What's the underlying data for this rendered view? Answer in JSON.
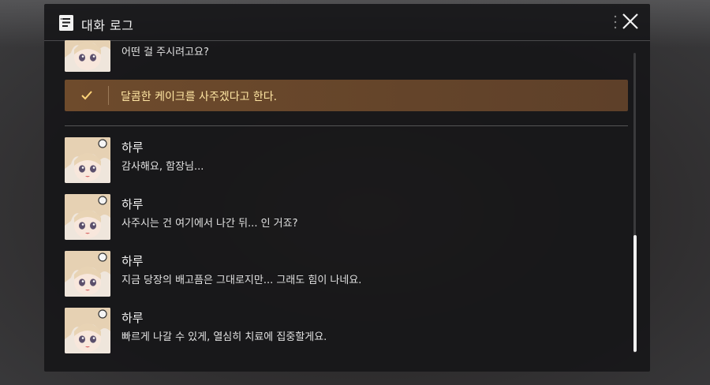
{
  "header": {
    "title": "대화 로그"
  },
  "choice": {
    "text": "달콤한 케이크를 사주겠다고 한다."
  },
  "entries": [
    {
      "speaker": "",
      "line": "어떤 걸 주시려고요?"
    },
    {
      "speaker": "하루",
      "line": "감사해요, 함장님..."
    },
    {
      "speaker": "하루",
      "line": "사주시는 건 여기에서 나간 뒤... 인 거죠?"
    },
    {
      "speaker": "하루",
      "line": "지금 당장의 배고픔은 그대로지만... 그래도 힘이 나네요."
    },
    {
      "speaker": "하루",
      "line": "빠르게 나갈 수 있게, 열심히 치료에 집중할게요."
    }
  ],
  "icons": {
    "log": "document-log-icon",
    "close": "close-icon",
    "check": "check-icon",
    "drag": "drag-dots-icon"
  },
  "colors": {
    "panel": "#161618",
    "choice_bg": "#6b4a2e",
    "choice_text": "#ffe6a3",
    "scroll_thumb": "#f0f0f0"
  }
}
